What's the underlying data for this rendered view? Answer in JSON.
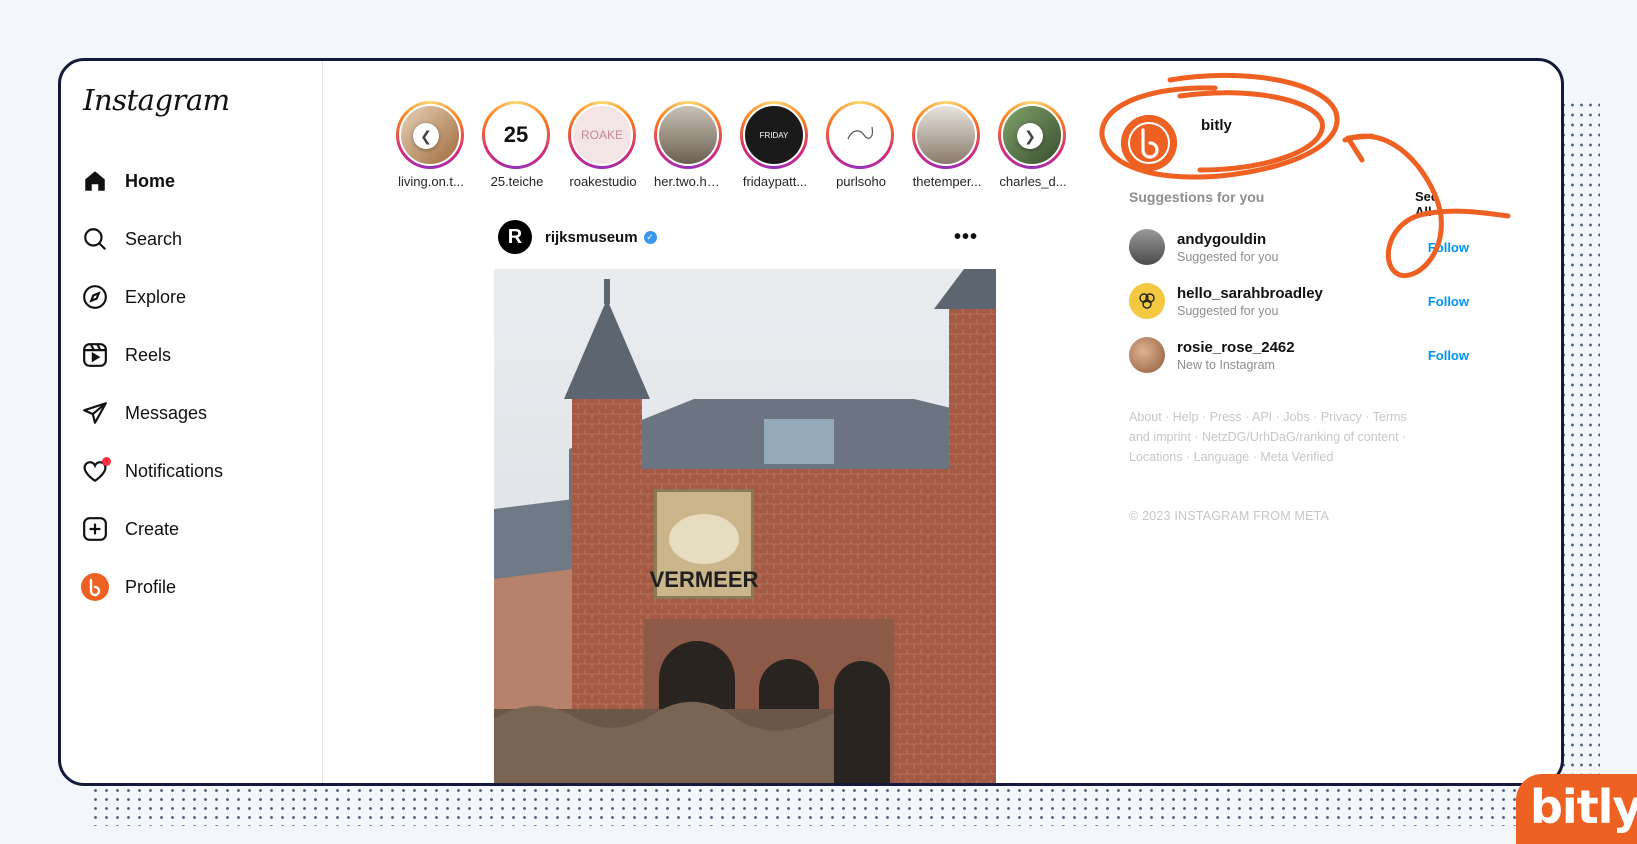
{
  "app": {
    "logo": "Instagram"
  },
  "nav": [
    {
      "label": "Home",
      "icon": "home-icon",
      "bold": true
    },
    {
      "label": "Search",
      "icon": "search-icon"
    },
    {
      "label": "Explore",
      "icon": "compass-icon"
    },
    {
      "label": "Reels",
      "icon": "reels-icon"
    },
    {
      "label": "Messages",
      "icon": "paper-plane-icon"
    },
    {
      "label": "Notifications",
      "icon": "heart-icon"
    },
    {
      "label": "Create",
      "icon": "plus-square-icon"
    },
    {
      "label": "Profile",
      "icon": "profile-avatar-icon"
    }
  ],
  "stories": [
    {
      "label": "living.on.t..."
    },
    {
      "label": "25.teiche",
      "inner": "25"
    },
    {
      "label": "roakestudio",
      "inner": "ROAKE"
    },
    {
      "label": "her.two.ha..."
    },
    {
      "label": "fridaypatt...",
      "inner": "FRIDAY"
    },
    {
      "label": "purlsoho"
    },
    {
      "label": "thetemper..."
    },
    {
      "label": "charles_d..."
    }
  ],
  "post": {
    "avatar_letter": "R",
    "user": "rijksmuseum",
    "more": "•••",
    "banner_text": "VERMEER"
  },
  "profile": {
    "name": "bitly"
  },
  "suggestions": {
    "title": "Suggestions for you",
    "see_all": "See All",
    "items": [
      {
        "name": "andygouldin",
        "sub": "Suggested for you",
        "action": "Follow"
      },
      {
        "name": "hello_sarahbroadley",
        "sub": "Suggested for you",
        "action": "Follow"
      },
      {
        "name": "rosie_rose_2462",
        "sub": "New to Instagram",
        "action": "Follow"
      }
    ]
  },
  "footer": {
    "links": [
      "About",
      "Help",
      "Press",
      "API",
      "Jobs",
      "Privacy",
      "Terms and imprint",
      "NetzDG/UrhDaG/ranking of content",
      "Locations",
      "Language",
      "Meta Verified"
    ],
    "copyright": "© 2023 INSTAGRAM FROM META"
  },
  "brand": {
    "badge": "bitly",
    "accent": "#ee6123",
    "ink": "#141a3c",
    "link_blue": "#0095f6"
  }
}
